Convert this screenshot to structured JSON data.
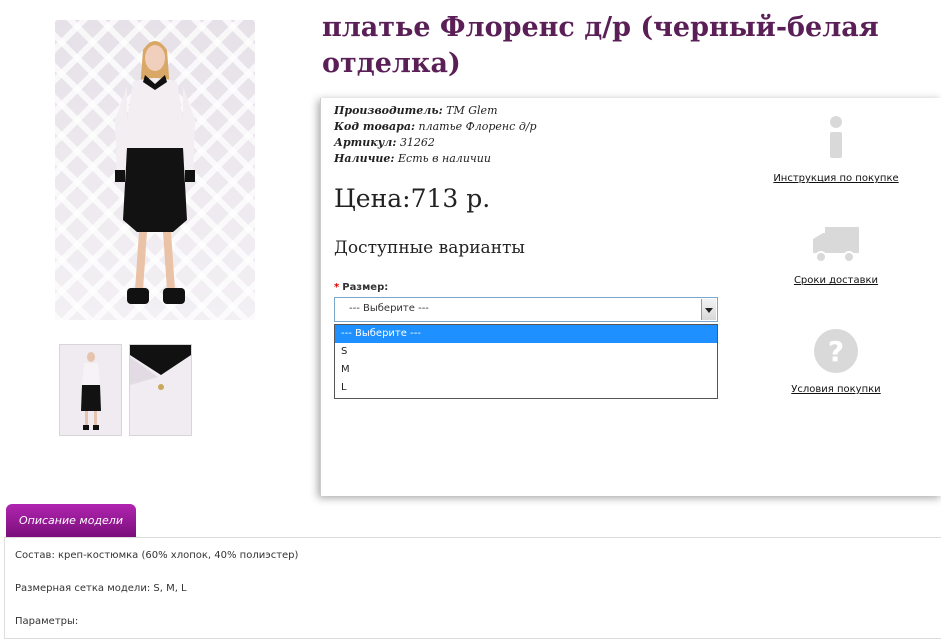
{
  "product": {
    "title": "платье Флоренс д/р (черный-белая отделка)",
    "manufacturer_label": "Производитель:",
    "manufacturer_value": "ТМ Glem",
    "code_label": "Код товара:",
    "code_value": "платье Флоренс д/р",
    "article_label": "Артикул:",
    "article_value": "31262",
    "availability_label": "Наличие:",
    "availability_value": "Есть в наличии",
    "price": "Цена:713 р.",
    "variants_heading": "Доступные варианты",
    "size_label": "Размер:",
    "size_selected": "--- Выберите ---",
    "size_options": [
      "--- Выберите ---",
      "S",
      "M",
      "L"
    ]
  },
  "side": {
    "instruction": "Инструкция по покупке",
    "delivery": "Сроки доставки",
    "conditions": "Условия покупки"
  },
  "tabs": {
    "description": "Описание модели"
  },
  "description": {
    "line1": "Состав: креп-костюмка (60% хлопок, 40% полиэстер)",
    "line2": "Размерная сетка модели: S, M, L",
    "line3": "Параметры:"
  },
  "colors": {
    "title": "#5a1f57",
    "tab": "#9a1a9a",
    "selected_option": "#1e90ff"
  }
}
